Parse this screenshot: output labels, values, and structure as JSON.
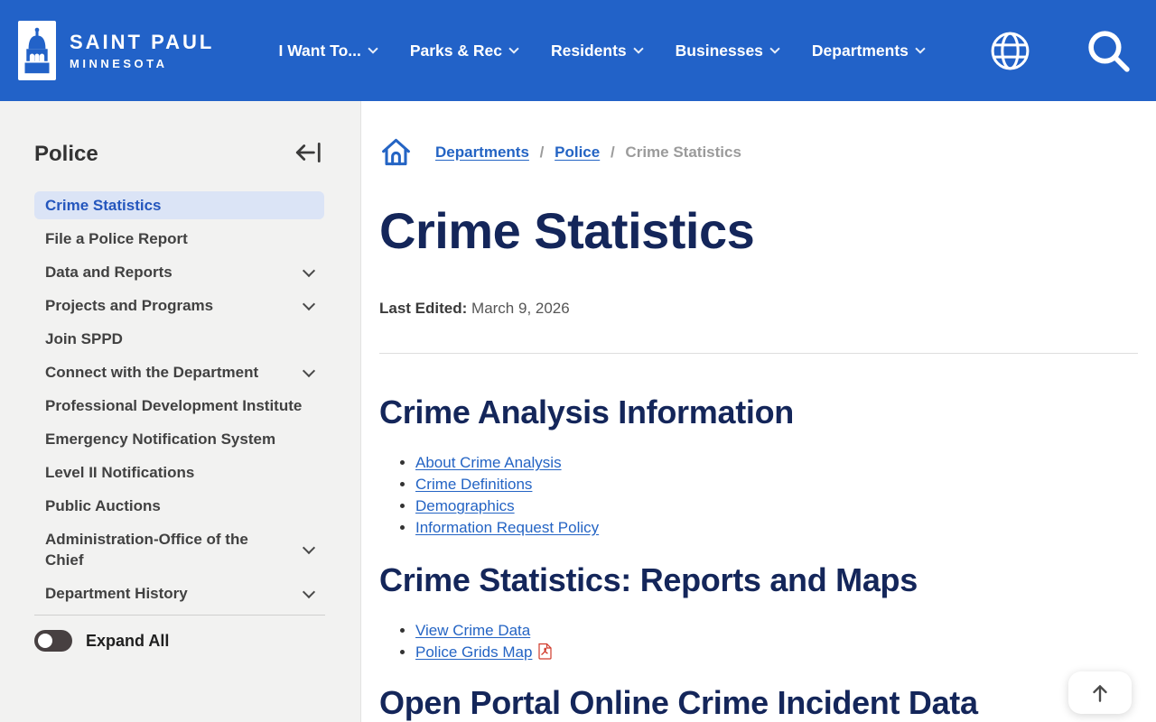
{
  "header": {
    "logo_line1": "SAINT PAUL",
    "logo_line2": "MINNESOTA",
    "nav": [
      {
        "label": "I Want To..."
      },
      {
        "label": "Parks & Rec"
      },
      {
        "label": "Residents"
      },
      {
        "label": "Businesses"
      },
      {
        "label": "Departments"
      }
    ]
  },
  "sidebar": {
    "title": "Police",
    "items": [
      {
        "label": "Crime Statistics",
        "active": true
      },
      {
        "label": "File a Police Report"
      },
      {
        "label": "Data and Reports",
        "expandable": true
      },
      {
        "label": "Projects and Programs",
        "expandable": true
      },
      {
        "label": "Join SPPD"
      },
      {
        "label": "Connect with the Department",
        "expandable": true
      },
      {
        "label": "Professional Development Institute"
      },
      {
        "label": "Emergency Notification System"
      },
      {
        "label": "Level II Notifications"
      },
      {
        "label": "Public Auctions"
      },
      {
        "label": "Administration-Office of the Chief",
        "expandable": true
      },
      {
        "label": "Department History",
        "expandable": true
      }
    ],
    "expand_all_label": "Expand All"
  },
  "breadcrumb": {
    "items": [
      {
        "label": "Departments"
      },
      {
        "label": "Police"
      }
    ],
    "separator": "/",
    "current": "Crime Statistics"
  },
  "page": {
    "title": "Crime Statistics",
    "last_edited_label": "Last Edited:",
    "last_edited_date": "March 9, 2026"
  },
  "sections": [
    {
      "heading": "Crime Analysis Information",
      "links": [
        {
          "label": "About Crime Analysis"
        },
        {
          "label": "Crime Definitions"
        },
        {
          "label": "Demographics"
        },
        {
          "label": "Information Request Policy"
        }
      ]
    },
    {
      "heading": "Crime Statistics: Reports and Maps",
      "links": [
        {
          "label": "View Crime Data"
        },
        {
          "label": "Police Grids Map",
          "file_type": "pdf"
        }
      ]
    },
    {
      "heading": "Open Portal Online Crime Incident Data",
      "links": []
    }
  ],
  "colors": {
    "header_blue": "#2262c8",
    "heading_navy": "#14265a",
    "link_blue": "#2464c4",
    "active_item_bg": "#dbe4f6",
    "active_item_text": "#2456bd",
    "sidebar_bg": "#f2f2f1",
    "pdf_red": "#d03b2c"
  }
}
